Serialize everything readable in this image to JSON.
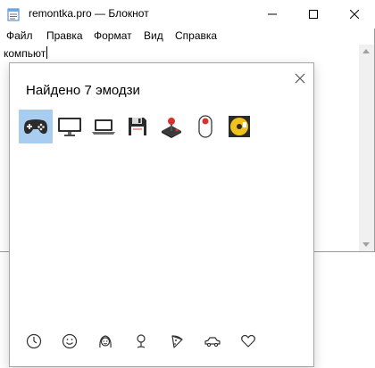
{
  "window": {
    "title": "remontka.pro — Блокнот",
    "icon": "notepad-icon",
    "controls": [
      "minimize-icon",
      "maximize-icon",
      "close-icon"
    ]
  },
  "menu": [
    "Файл",
    "Правка",
    "Формат",
    "Вид",
    "Справка"
  ],
  "editor": {
    "text": "компьют"
  },
  "emoji_panel": {
    "heading": "Найдено 7 эмодзи",
    "results": [
      {
        "icon": "game-controller-icon",
        "selected": true
      },
      {
        "icon": "desktop-computer-icon",
        "selected": false
      },
      {
        "icon": "laptop-icon",
        "selected": false
      },
      {
        "icon": "floppy-disk-icon",
        "selected": false
      },
      {
        "icon": "joystick-icon",
        "selected": false
      },
      {
        "icon": "computer-mouse-icon",
        "selected": false
      },
      {
        "icon": "optical-disc-icon",
        "selected": false
      }
    ],
    "categories": [
      "recent-clock-icon",
      "smiley-icon",
      "people-icon",
      "location-pin-icon",
      "food-pizza-icon",
      "car-icon",
      "heart-icon"
    ],
    "selection_color": "#a8cdf0"
  }
}
